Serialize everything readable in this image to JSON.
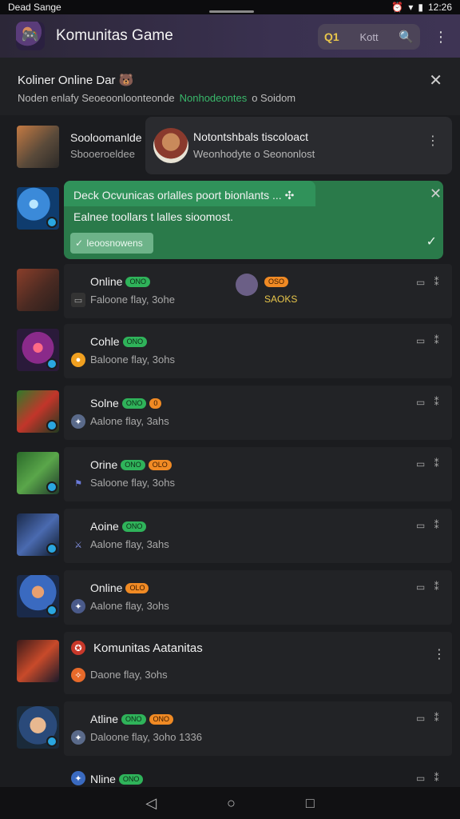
{
  "status_bar": {
    "left": "Dead Sange",
    "right": "12:26"
  },
  "app_bar": {
    "title": "Komunitas Game",
    "search_q": "Q1",
    "search_text": "Kott"
  },
  "notification": {
    "title": "Koliner Online Dar",
    "sub_text": "Noden enlafy Seoeoonloonteonde",
    "sub_link": "Nonhodeontes",
    "sub_suffix": "o Soidom"
  },
  "popup": {
    "title": "Notontshbals tiscoloact",
    "subtitle": "Weonhodyte o Seononlost"
  },
  "toast": {
    "title": "Deck Ocvunicas orlalles poort bionlants ...",
    "body": "Ealnee toollars t lalles sioomost.",
    "button": "Ieoosnowens"
  },
  "rows": [
    {
      "name": "Sooloomanlde",
      "meta": "Sbooeroeldee"
    },
    {
      "name": "Online",
      "pill1": "ONO",
      "meta": "Faloone flay, 3ohe",
      "extra": "SAOKS"
    },
    {
      "name": "Cohle",
      "pill1": "ONO",
      "meta": "Baloone flay, 3ohs"
    },
    {
      "name": "Solne",
      "pill1": "ONO",
      "pill2": "0",
      "meta": "Aalone flay, 3ahs"
    },
    {
      "name": "Orine",
      "pill1": "ONO",
      "pill2": "OLO",
      "meta": "Saloone flay, 3ohs"
    },
    {
      "name": "Aoine",
      "pill1": "ONO",
      "meta": "Aalone flay, 3ahs"
    },
    {
      "name": "Online",
      "pill1": "OLO",
      "meta": "Aalone flay, 3ohs"
    },
    {
      "name": "Komunitas Aatanitas",
      "meta": "Daone flay, 3ohs"
    },
    {
      "name": "Atline",
      "pill1": "ONO",
      "pill2": "ONO",
      "meta": "Daloone flay, 3oho 1336"
    },
    {
      "name": "Nline",
      "pill1": "ONO"
    }
  ],
  "colors": {
    "accent_green": "#2fb35a",
    "accent_orange": "#f08a24",
    "toast_bg": "#2a7a4a",
    "app_bar": "#3a3150"
  },
  "icons": {
    "nav_back": "◁",
    "nav_home": "○",
    "nav_recent": "□",
    "close": "✕",
    "search": "🔍",
    "more": "⋮"
  }
}
